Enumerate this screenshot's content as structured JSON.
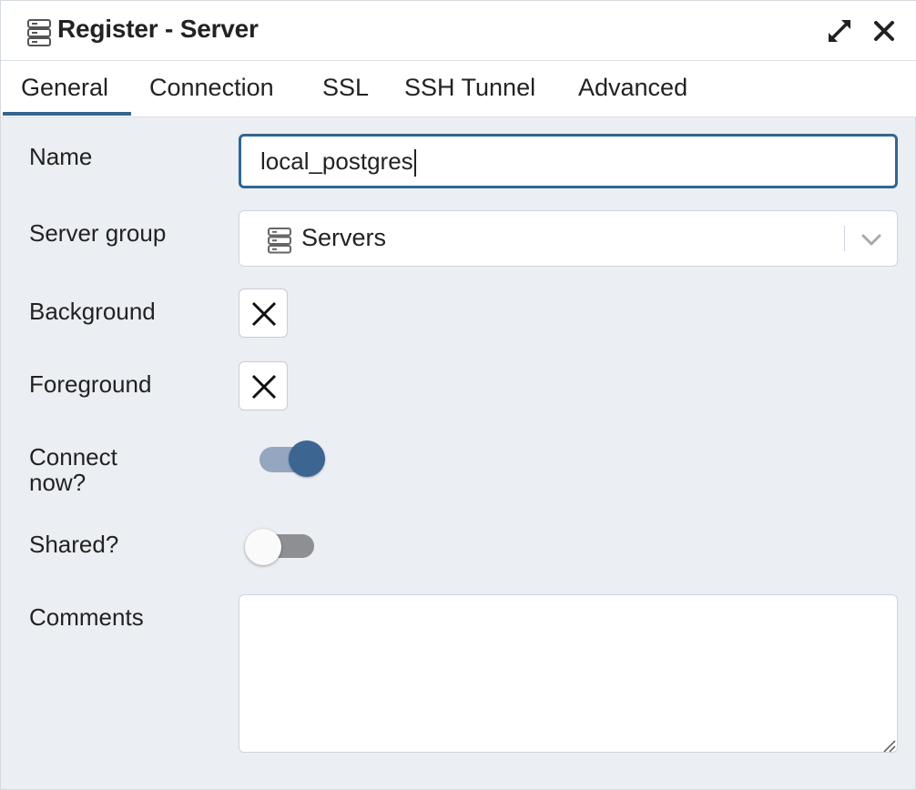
{
  "dialog": {
    "title": "Register - Server",
    "title_icon": "server-icon",
    "controls": {
      "expand_icon": "expand-icon",
      "close_icon": "close-icon"
    }
  },
  "tabs": [
    {
      "label": "General",
      "active": true
    },
    {
      "label": "Connection",
      "active": false
    },
    {
      "label": "SSL",
      "active": false
    },
    {
      "label": "SSH Tunnel",
      "active": false
    },
    {
      "label": "Advanced",
      "active": false
    }
  ],
  "form": {
    "name": {
      "label": "Name",
      "value": "local_postgres"
    },
    "server_group": {
      "label": "Server group",
      "value": "Servers",
      "icon": "server-group-icon"
    },
    "background": {
      "label": "Background",
      "value": "none"
    },
    "foreground": {
      "label": "Foreground",
      "value": "none"
    },
    "connect_now": {
      "label_line1": "Connect",
      "label_line2": "now?",
      "checked": true
    },
    "shared": {
      "label": "Shared?",
      "checked": false
    },
    "comments": {
      "label": "Comments",
      "value": ""
    }
  },
  "colors": {
    "accent": "#326690",
    "toggle_on_knob": "#3d6592",
    "toggle_on_track": "#94a6c0",
    "toggle_off_track": "#8d8f93",
    "panel_bg": "#ebeef3"
  }
}
